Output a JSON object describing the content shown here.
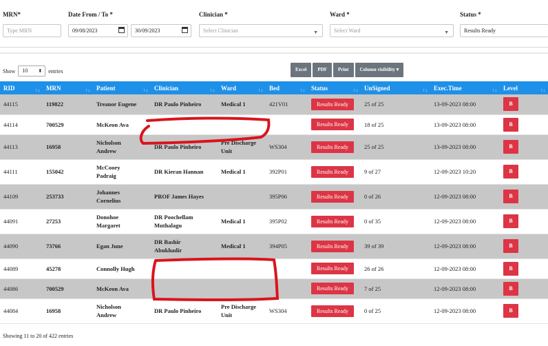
{
  "filters": {
    "mrn_label": "MRN*",
    "mrn_placeholder": "Type MRN",
    "date_label": "Date From / To *",
    "date_from": "09/08/2023",
    "date_to": "30/09/2023",
    "clinician_label": "Clinician *",
    "clinician_placeholder": "Select Clinician",
    "ward_label": "Ward *",
    "ward_placeholder": "Select Ward",
    "status_label": "Status *",
    "status_value": "Results Ready"
  },
  "length": {
    "show": "Show",
    "value": "10",
    "entries": "entries"
  },
  "buttons": {
    "excel": "Excel",
    "pdf": "PDF",
    "print": "Print",
    "colvis": "Column visibility"
  },
  "columns": [
    "RID",
    "MRN",
    "Patient",
    "Clinician",
    "Ward",
    "Bed",
    "Status",
    "UnSigned",
    "Exec.Time",
    "Level"
  ],
  "rows": [
    {
      "rid": "44115",
      "mrn": "119822",
      "patient": "Treanor Eugene",
      "clinician": "DR Paulo Pinheiro",
      "ward": "Medical 1",
      "bed": "421V01",
      "status": "Results Ready",
      "unsigned": "25 of 25",
      "exec": "13-09-2023 08:00",
      "level": "B"
    },
    {
      "rid": "44114",
      "mrn": "700529",
      "patient": "McKeon Ava",
      "clinician": "",
      "ward": "",
      "bed": "",
      "status": "Results Ready",
      "unsigned": "18 of 25",
      "exec": "13-09-2023 08:00",
      "level": "B"
    },
    {
      "rid": "44113",
      "mrn": "16958",
      "patient": "Nicholson Andrew",
      "clinician": "DR Paulo Pinheiro",
      "ward": "Pre Discharge Unit",
      "bed": "WS304",
      "status": "Results Ready",
      "unsigned": "25 of 25",
      "exec": "13-09-2023 08:00",
      "level": "B"
    },
    {
      "rid": "44111",
      "mrn": "155042",
      "patient": "McCooey Padraig",
      "clinician": "DR Kieran Hannan",
      "ward": "Medical 1",
      "bed": "392P01",
      "status": "Results Ready",
      "unsigned": "9 of 27",
      "exec": "12-09-2023 10:20",
      "level": "B"
    },
    {
      "rid": "44109",
      "mrn": "253733",
      "patient": "Johannes Cornelius",
      "clinician": "PROF James Hayes",
      "ward": "",
      "bed": "395P06",
      "status": "Results Ready",
      "unsigned": "0 of 26",
      "exec": "12-09-2023 08:00",
      "level": "B"
    },
    {
      "rid": "44091",
      "mrn": "27253",
      "patient": "Donohoe Margaret",
      "clinician": "DR Poochellam Muthalagu",
      "ward": "Medical 1",
      "bed": "395P02",
      "status": "Results Ready",
      "unsigned": "0 of 35",
      "exec": "12-09-2023 08:00",
      "level": "B"
    },
    {
      "rid": "44090",
      "mrn": "73766",
      "patient": "Egan June",
      "clinician": "DR Bashir Abukhadir",
      "ward": "Medical 1",
      "bed": "394P05",
      "status": "Results Ready",
      "unsigned": "39 of 39",
      "exec": "12-09-2023 08:00",
      "level": "B"
    },
    {
      "rid": "44089",
      "mrn": "45278",
      "patient": "Connolly Hugh",
      "clinician": "",
      "ward": "",
      "bed": "",
      "status": "Results Ready",
      "unsigned": "26 of 26",
      "exec": "12-09-2023 08:00",
      "level": "B"
    },
    {
      "rid": "44086",
      "mrn": "700529",
      "patient": "McKeon Ava",
      "clinician": "",
      "ward": "",
      "bed": "",
      "status": "Results Ready",
      "unsigned": "7 of 25",
      "exec": "12-09-2023 08:00",
      "level": "B"
    },
    {
      "rid": "44084",
      "mrn": "16958",
      "patient": "Nicholson Andrew",
      "clinician": "DR Paulo Pinheiro",
      "ward": "Pre Discharge Unit",
      "bed": "WS304",
      "status": "Results Ready",
      "unsigned": "0 of 25",
      "exec": "12-09-2023 08:00",
      "level": "B"
    }
  ],
  "footer": "Showing 11 to 20 of 422 entries",
  "colors": {
    "header": "#1e90e8",
    "status": "#dc3545",
    "odd_row": "#c7c7c7",
    "button": "#6c757d",
    "redaction": "#d9141c"
  }
}
